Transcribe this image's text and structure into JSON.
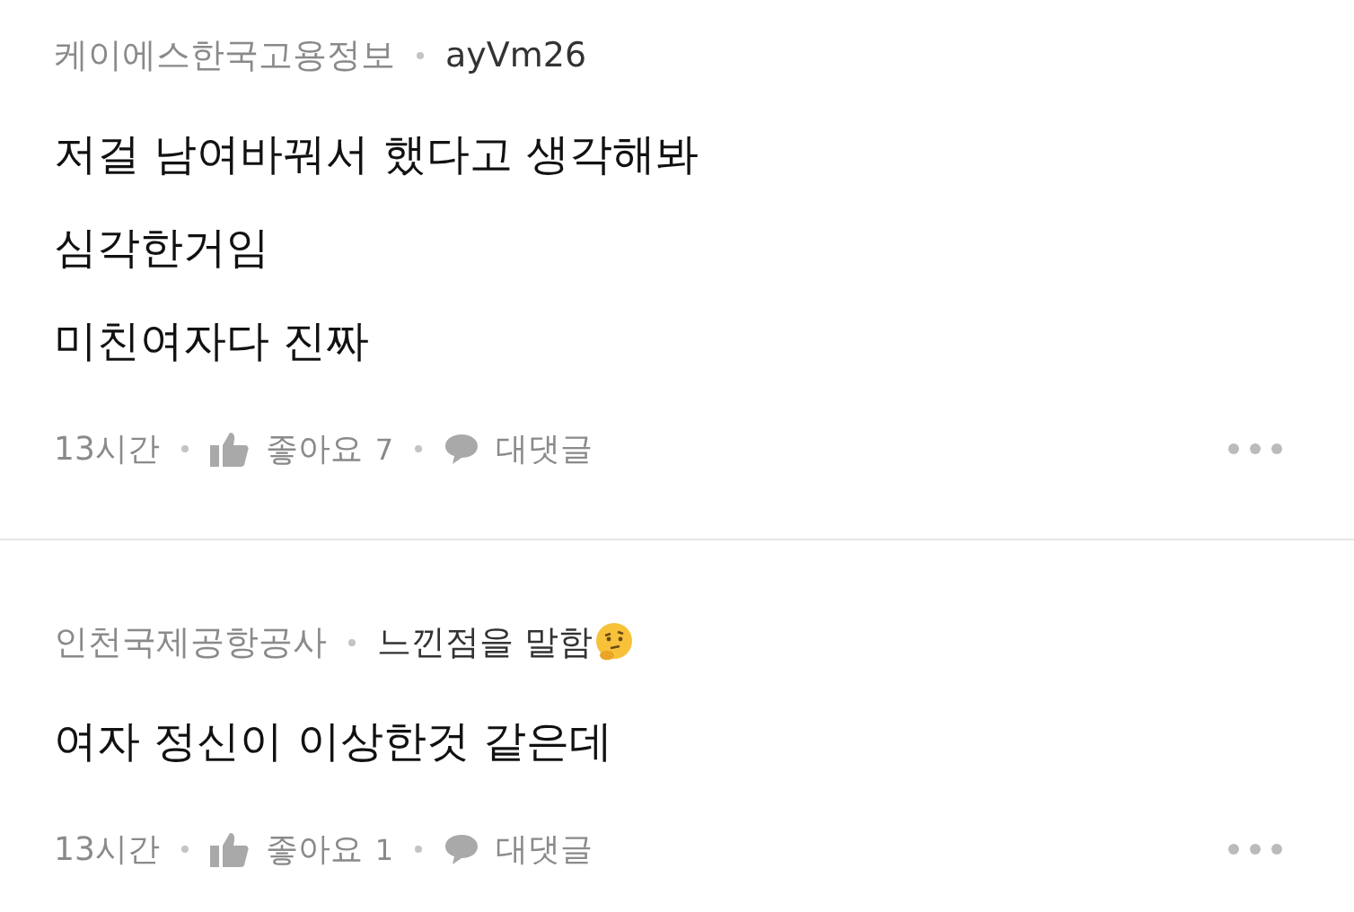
{
  "comments": [
    {
      "company": "케이에스한국고용정보",
      "nickname": "ayVm26",
      "nickname_emoji": false,
      "lines": [
        "저걸 남여바꿔서 했다고 생각해봐",
        "심각한거임",
        "미친여자다 진짜"
      ],
      "time": "13시간",
      "like_label": "좋아요",
      "like_count": "7",
      "reply_label": "대댓글"
    },
    {
      "company": "인천국제공항공사",
      "nickname": "느낀점을 말함",
      "nickname_emoji": true,
      "lines": [
        "여자 정신이 이상한것 같은데"
      ],
      "time": "13시간",
      "like_label": "좋아요",
      "like_count": "1",
      "reply_label": "대댓글"
    }
  ]
}
